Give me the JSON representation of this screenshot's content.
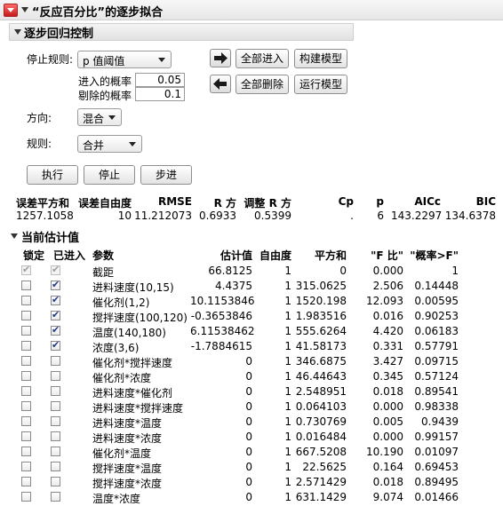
{
  "report": {
    "title": "“反应百分比”的逐步拟合"
  },
  "control": {
    "title": "逐步回归控制",
    "stop_rule_label": "停止规则:",
    "stop_rule_value": "p 值阈值",
    "enter_prob_label": "进入的概率",
    "enter_prob_value": "0.05",
    "remove_prob_label": "剔除的概率",
    "remove_prob_value": "0.1",
    "direction_label": "方向:",
    "direction_value": "混合",
    "rules_label": "规则:",
    "rules_value": "合并",
    "buttons": {
      "enter_all": "全部进入",
      "build_model": "构建模型",
      "remove_all": "全部删除",
      "run_model": "运行模型",
      "go": "执行",
      "stop": "停止",
      "step": "步进"
    }
  },
  "summary": {
    "headers": [
      "误差平方和",
      "误差自由度",
      "RMSE",
      "R 方",
      "调整 R 方",
      "Cp",
      "p",
      "AICc",
      "BIC"
    ],
    "values": [
      "1257.1058",
      "10",
      "11.212073",
      "0.6933",
      "0.5399",
      ".",
      "6",
      "143.2297",
      "134.6378"
    ]
  },
  "estimates": {
    "title": "当前估计值",
    "headers": [
      "锁定",
      "已进入",
      "参数",
      "估计值",
      "自由度",
      "平方和",
      "\"F 比\"",
      "\"概率>F\""
    ],
    "rows": [
      {
        "lock": true,
        "lock_disabled": true,
        "entered": true,
        "entered_disabled": true,
        "param": "截距",
        "est": "66.8125",
        "df": "1",
        "ss": "0",
        "f": "0.000",
        "p": "1"
      },
      {
        "lock": false,
        "entered": true,
        "param": "进料速度(10,15)",
        "est": "4.4375",
        "df": "1",
        "ss": "315.0625",
        "f": "2.506",
        "p": "0.14448"
      },
      {
        "lock": false,
        "entered": true,
        "param": "催化剂(1,2)",
        "est": "10.1153846",
        "df": "1",
        "ss": "1520.198",
        "f": "12.093",
        "p": "0.00595"
      },
      {
        "lock": false,
        "entered": true,
        "param": "搅拌速度(100,120)",
        "est": "-0.3653846",
        "df": "1",
        "ss": "1.983516",
        "f": "0.016",
        "p": "0.90253"
      },
      {
        "lock": false,
        "entered": true,
        "param": "温度(140,180)",
        "est": "6.11538462",
        "df": "1",
        "ss": "555.6264",
        "f": "4.420",
        "p": "0.06183"
      },
      {
        "lock": false,
        "entered": true,
        "param": "浓度(3,6)",
        "est": "-1.7884615",
        "df": "1",
        "ss": "41.58173",
        "f": "0.331",
        "p": "0.57791"
      },
      {
        "lock": false,
        "entered": false,
        "param": "催化剂*搅拌速度",
        "est": "0",
        "df": "1",
        "ss": "346.6875",
        "f": "3.427",
        "p": "0.09715"
      },
      {
        "lock": false,
        "entered": false,
        "param": "催化剂*浓度",
        "est": "0",
        "df": "1",
        "ss": "46.44643",
        "f": "0.345",
        "p": "0.57124"
      },
      {
        "lock": false,
        "entered": false,
        "param": "进料速度*催化剂",
        "est": "0",
        "df": "1",
        "ss": "2.548951",
        "f": "0.018",
        "p": "0.89541"
      },
      {
        "lock": false,
        "entered": false,
        "param": "进料速度*搅拌速度",
        "est": "0",
        "df": "1",
        "ss": "0.064103",
        "f": "0.000",
        "p": "0.98338"
      },
      {
        "lock": false,
        "entered": false,
        "param": "进料速度*温度",
        "est": "0",
        "df": "1",
        "ss": "0.730769",
        "f": "0.005",
        "p": "0.9439"
      },
      {
        "lock": false,
        "entered": false,
        "param": "进料速度*浓度",
        "est": "0",
        "df": "1",
        "ss": "0.016484",
        "f": "0.000",
        "p": "0.99157"
      },
      {
        "lock": false,
        "entered": false,
        "param": "催化剂*温度",
        "est": "0",
        "df": "1",
        "ss": "667.5208",
        "f": "10.190",
        "p": "0.01097"
      },
      {
        "lock": false,
        "entered": false,
        "param": "搅拌速度*温度",
        "est": "0",
        "df": "1",
        "ss": "22.5625",
        "f": "0.164",
        "p": "0.69453"
      },
      {
        "lock": false,
        "entered": false,
        "param": "搅拌速度*浓度",
        "est": "0",
        "df": "1",
        "ss": "2.571429",
        "f": "0.018",
        "p": "0.89495"
      },
      {
        "lock": false,
        "entered": false,
        "param": "温度*浓度",
        "est": "0",
        "df": "1",
        "ss": "631.1429",
        "f": "9.074",
        "p": "0.01466"
      }
    ]
  }
}
